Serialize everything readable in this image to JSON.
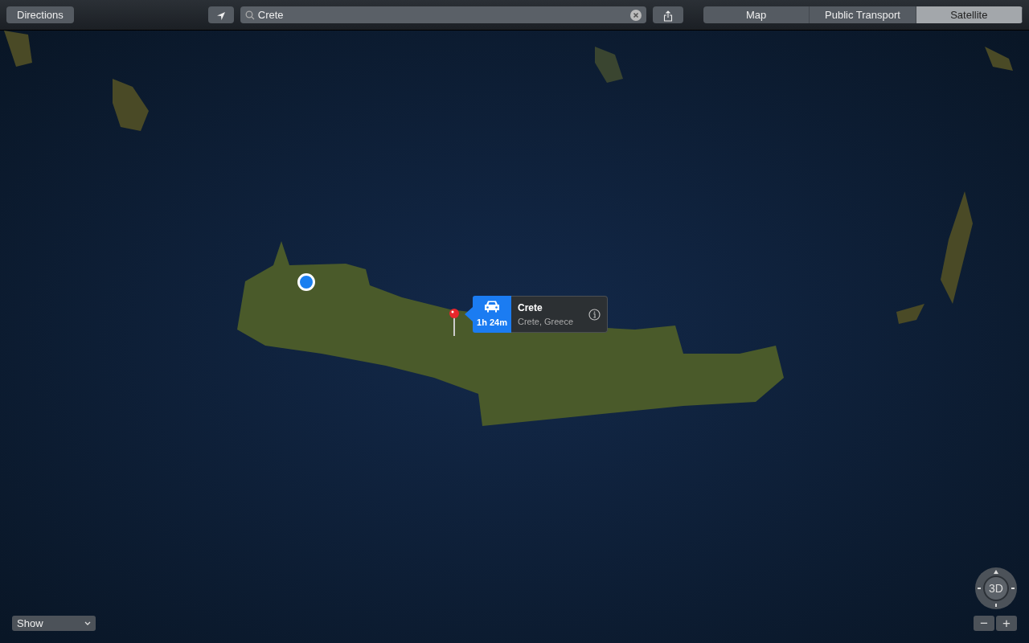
{
  "toolbar": {
    "directions_button": "Directions",
    "search": {
      "value": "Crete"
    },
    "view_tabs": [
      {
        "label": "Map",
        "selected": false
      },
      {
        "label": "Public Transport",
        "selected": false
      },
      {
        "label": "Satellite",
        "selected": true
      }
    ]
  },
  "callout": {
    "travel_time": "1h 24m",
    "title": "Crete",
    "subtitle": "Crete, Greece"
  },
  "show_menu": {
    "value": "Show"
  },
  "compass": {
    "label": "3D"
  },
  "zoom_buttons": [
    "−",
    "+"
  ]
}
